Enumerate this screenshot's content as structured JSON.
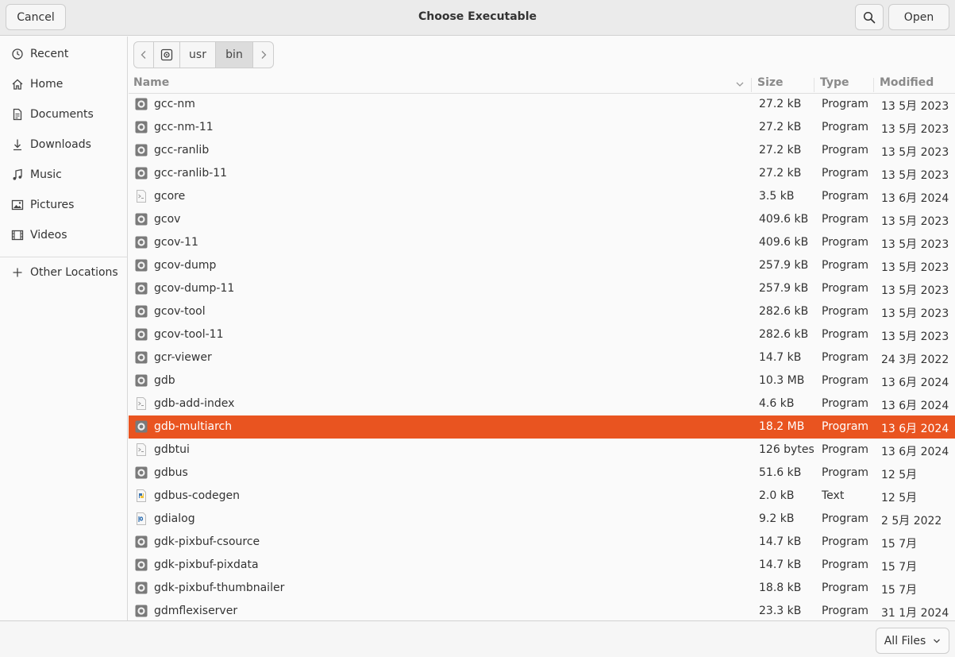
{
  "header": {
    "title": "Choose Executable",
    "cancel_label": "Cancel",
    "open_label": "Open"
  },
  "sidebar": {
    "items": [
      {
        "label": "Recent",
        "icon": "clock-icon"
      },
      {
        "label": "Home",
        "icon": "home-icon"
      },
      {
        "label": "Documents",
        "icon": "document-icon"
      },
      {
        "label": "Downloads",
        "icon": "download-icon"
      },
      {
        "label": "Music",
        "icon": "music-icon"
      },
      {
        "label": "Pictures",
        "icon": "pictures-icon"
      },
      {
        "label": "Videos",
        "icon": "video-icon"
      }
    ],
    "other_locations": "Other Locations"
  },
  "pathbar": {
    "segments": [
      "usr",
      "bin"
    ]
  },
  "columns": {
    "name": "Name",
    "size": "Size",
    "type": "Type",
    "modified": "Modified"
  },
  "files": [
    {
      "name": "gcc-nm",
      "size": "27.2 kB",
      "type": "Program",
      "modified": "13 5月 2023",
      "icon": "executable-icon"
    },
    {
      "name": "gcc-nm-11",
      "size": "27.2 kB",
      "type": "Program",
      "modified": "13 5月 2023",
      "icon": "executable-icon"
    },
    {
      "name": "gcc-ranlib",
      "size": "27.2 kB",
      "type": "Program",
      "modified": "13 5月 2023",
      "icon": "executable-icon"
    },
    {
      "name": "gcc-ranlib-11",
      "size": "27.2 kB",
      "type": "Program",
      "modified": "13 5月 2023",
      "icon": "executable-icon"
    },
    {
      "name": "gcore",
      "size": "3.5 kB",
      "type": "Program",
      "modified": "13 6月 2024",
      "icon": "script-icon"
    },
    {
      "name": "gcov",
      "size": "409.6 kB",
      "type": "Program",
      "modified": "13 5月 2023",
      "icon": "executable-icon"
    },
    {
      "name": "gcov-11",
      "size": "409.6 kB",
      "type": "Program",
      "modified": "13 5月 2023",
      "icon": "executable-icon"
    },
    {
      "name": "gcov-dump",
      "size": "257.9 kB",
      "type": "Program",
      "modified": "13 5月 2023",
      "icon": "executable-icon"
    },
    {
      "name": "gcov-dump-11",
      "size": "257.9 kB",
      "type": "Program",
      "modified": "13 5月 2023",
      "icon": "executable-icon"
    },
    {
      "name": "gcov-tool",
      "size": "282.6 kB",
      "type": "Program",
      "modified": "13 5月 2023",
      "icon": "executable-icon"
    },
    {
      "name": "gcov-tool-11",
      "size": "282.6 kB",
      "type": "Program",
      "modified": "13 5月 2023",
      "icon": "executable-icon"
    },
    {
      "name": "gcr-viewer",
      "size": "14.7 kB",
      "type": "Program",
      "modified": "24 3月 2022",
      "icon": "executable-icon"
    },
    {
      "name": "gdb",
      "size": "10.3 MB",
      "type": "Program",
      "modified": "13 6月 2024",
      "icon": "executable-icon"
    },
    {
      "name": "gdb-add-index",
      "size": "4.6 kB",
      "type": "Program",
      "modified": "13 6月 2024",
      "icon": "script-icon"
    },
    {
      "name": "gdb-multiarch",
      "size": "18.2 MB",
      "type": "Program",
      "modified": "13 6月 2024",
      "icon": "executable-icon",
      "selected": true
    },
    {
      "name": "gdbtui",
      "size": "126 bytes",
      "type": "Program",
      "modified": "13 6月 2024",
      "icon": "script-icon"
    },
    {
      "name": "gdbus",
      "size": "51.6 kB",
      "type": "Program",
      "modified": "12 5月",
      "icon": "executable-icon"
    },
    {
      "name": "gdbus-codegen",
      "size": "2.0 kB",
      "type": "Text",
      "modified": "12 5月",
      "icon": "python-icon"
    },
    {
      "name": "gdialog",
      "size": "9.2 kB",
      "type": "Program",
      "modified": "2 5月 2022",
      "icon": "perl-icon"
    },
    {
      "name": "gdk-pixbuf-csource",
      "size": "14.7 kB",
      "type": "Program",
      "modified": "15 7月",
      "icon": "executable-icon"
    },
    {
      "name": "gdk-pixbuf-pixdata",
      "size": "14.7 kB",
      "type": "Program",
      "modified": "15 7月",
      "icon": "executable-icon"
    },
    {
      "name": "gdk-pixbuf-thumbnailer",
      "size": "18.8 kB",
      "type": "Program",
      "modified": "15 7月",
      "icon": "executable-icon"
    },
    {
      "name": "gdmflexiserver",
      "size": "23.3 kB",
      "type": "Program",
      "modified": "31 1月 2024",
      "icon": "executable-icon"
    }
  ],
  "footer": {
    "filter_label": "All Files"
  },
  "colors": {
    "selection": "#e95420"
  }
}
